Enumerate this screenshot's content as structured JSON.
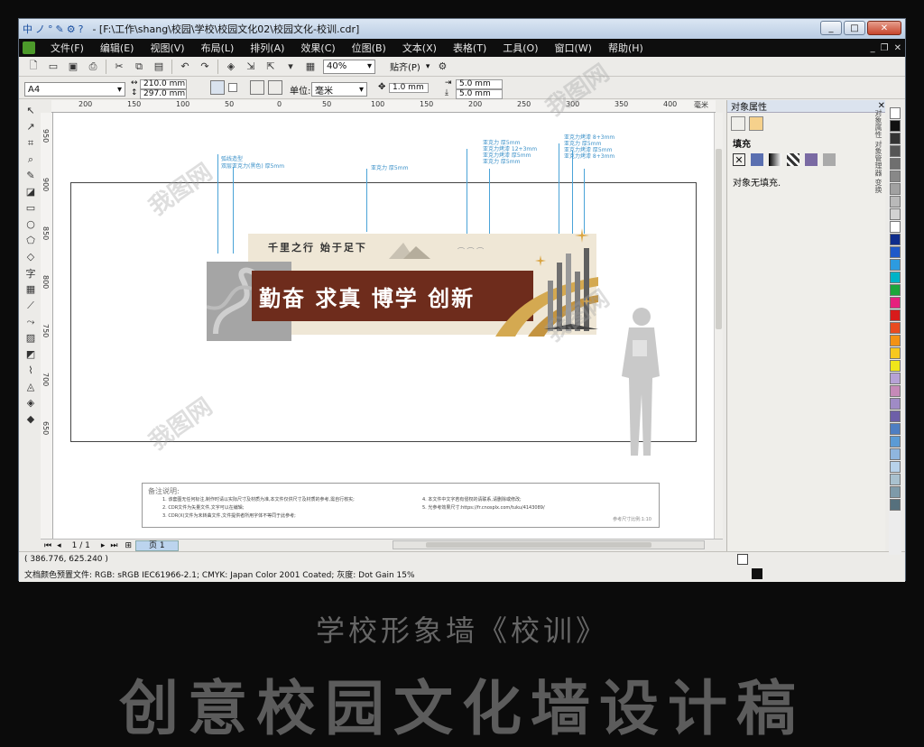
{
  "window": {
    "title": "- [F:\\工作\\shang\\校园\\学校\\校园文化02\\校园文化-校训.cdr]",
    "ime": [
      "中",
      "ノ",
      "°",
      "✎",
      "⚙",
      "?"
    ],
    "controls": {
      "min": "_",
      "max": "□",
      "close": "✕"
    }
  },
  "menubar": {
    "items": [
      "文件(F)",
      "编辑(E)",
      "视图(V)",
      "布局(L)",
      "排列(A)",
      "效果(C)",
      "位图(B)",
      "文本(X)",
      "表格(T)",
      "工具(O)",
      "窗口(W)",
      "帮助(H)"
    ]
  },
  "toolbar": {
    "zoom": "40%",
    "snap_label": "贴齐(P)"
  },
  "propertybar": {
    "page_size": "A4",
    "width": "210.0 mm",
    "height": "297.0 mm",
    "unit_label": "单位:",
    "unit": "毫米",
    "nudge": "1.0 mm",
    "dup_x": "5.0 mm",
    "dup_y": "5.0 mm"
  },
  "ruler": {
    "h_ticks": [
      "200",
      "150",
      "100",
      "50",
      "0",
      "50",
      "100",
      "150",
      "200",
      "250",
      "300",
      "350",
      "400"
    ],
    "h_unit": "毫米",
    "v_ticks": [
      "950",
      "900",
      "850",
      "800",
      "750",
      "700",
      "650"
    ]
  },
  "design": {
    "slogan_small": "千里之行  始于足下",
    "motto": "勤奋 求真 博学 创新",
    "annotations_left": [
      "弧线造型",
      "双层亚克力(黑色) 厚5mm"
    ],
    "annotation_mid": "亚克力 厚5mm",
    "annotations_right": [
      "亚克力 厚5mm",
      "亚克力烤漆 12+3mm",
      "亚克力烤漆 厚5mm",
      "亚克力 厚5mm",
      "亚克力烤漆 8+3mm",
      "亚克力 厚5mm",
      "亚克力烤漆 厚5mm",
      "亚克力烤漆 8+3mm"
    ],
    "notes_title": "备注说明:",
    "notes_left": [
      "1. 该套图无任何标注,制作时请以实际尺寸及材质为准,本文件仅供尺寸及材质的参考,需自行核实;",
      "2. CDR文件为矢量文件,文字可以在编辑;",
      "3. CDR(X)文件为未转曲文件,文件提供者所用字体不等同于此参考;"
    ],
    "notes_right": [
      "4. 本文件中文字若有侵权的请联系,请删除或修改;",
      "5. 光参考效果尺寸:https://fr.cnosplx.com/tuku/4143089/"
    ],
    "notes_scale": "参考尺寸比例:1:10"
  },
  "page_nav": {
    "counter": "1 / 1",
    "tab": "页 1"
  },
  "status": {
    "coords": "( 386.776, 625.240 )",
    "color_profile": "文档颜色预置文件: RGB: sRGB IEC61966-2.1; CMYK: Japan Color 2001 Coated; 灰度: Dot Gain 15%"
  },
  "docker": {
    "title": "对象属性",
    "fill_header": "填充",
    "fill_value": "对象无填充.",
    "side_tabs": [
      "对象属性",
      "对象管理器",
      "变换",
      "调和",
      "对齐与分布"
    ]
  },
  "palette": [
    "#111111",
    "#333333",
    "#555555",
    "#6f6f6f",
    "#888888",
    "#a1a1a1",
    "#b9b9b9",
    "#d2d2d2",
    "#ffffff",
    "#0f2d8c",
    "#1f59c9",
    "#2d9be0",
    "#00b3c7",
    "#1da63b",
    "#e6207e",
    "#d81b1b",
    "#e94b20",
    "#f39214",
    "#f7c81e",
    "#efe61a",
    "#b6a2d6",
    "#c58ab8",
    "#9f8bc5",
    "#6d5fa8",
    "#4e7ec2",
    "#5b9bd5",
    "#8fb6de",
    "#b7d2ea",
    "#a9c1cf",
    "#7e9aa9",
    "#56707d"
  ],
  "promo": {
    "subtitle": "学校形象墙《校训》",
    "title": "创意校园文化墙设计稿"
  },
  "watermark": "我图网"
}
